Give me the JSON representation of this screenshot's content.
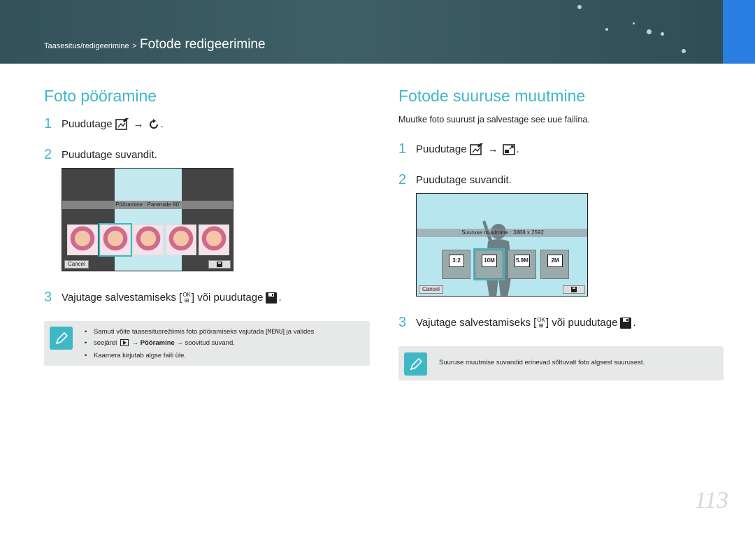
{
  "header": {
    "breadcrumb_parent": "Taasesitus/redigeerimine",
    "breadcrumb_sep": ">",
    "breadcrumb_current": "Fotode redigeerimine"
  },
  "left": {
    "title": "Foto pööramine",
    "step1": {
      "num": "1",
      "text": "Puudutage",
      "arrow": "→",
      "end": "."
    },
    "step2": {
      "num": "2",
      "text": "Puudutage suvandit."
    },
    "screen": {
      "bar_label": "Pööramine : Paremale 90˚",
      "cancel": "Cancel"
    },
    "step3": {
      "num": "3",
      "text_a": "Vajutage salvestamiseks [",
      "text_b": "] või puudutage",
      "end": "."
    },
    "note_items": [
      {
        "a": "Samuti võite taasesitusrežiimis foto pööramiseks vajutada [",
        "menu": "MENU",
        "b": "] ja valides"
      },
      {
        "a": "seejärel",
        "arrow": "→",
        "bold": "Pööramine",
        "b": "→ soovitud suvand."
      },
      {
        "a": "Kaamera kirjutab algse faili üle."
      }
    ]
  },
  "right": {
    "title": "Fotode suuruse muutmine",
    "intro": "Muutke foto suurust ja salvestage see uue failina.",
    "step1": {
      "num": "1",
      "text": "Puudutage",
      "arrow": "→",
      "end": "."
    },
    "step2": {
      "num": "2",
      "text": "Puudutage suvandit."
    },
    "screen": {
      "bar_label": "Suuruse muutmine : 3888 x 2592",
      "cancel": "Cancel",
      "options": [
        "3:2",
        "10M",
        "5.9M",
        "2M"
      ]
    },
    "step3": {
      "num": "3",
      "text_a": "Vajutage salvestamiseks [",
      "text_b": "] või puudutage",
      "end": "."
    },
    "note": "Suuruse muutmise suvandid erinevad sõltuvalt foto algsest suurusest."
  },
  "ok_button": {
    "top": "OK",
    "bottom": "⊞"
  },
  "page_number": "113"
}
